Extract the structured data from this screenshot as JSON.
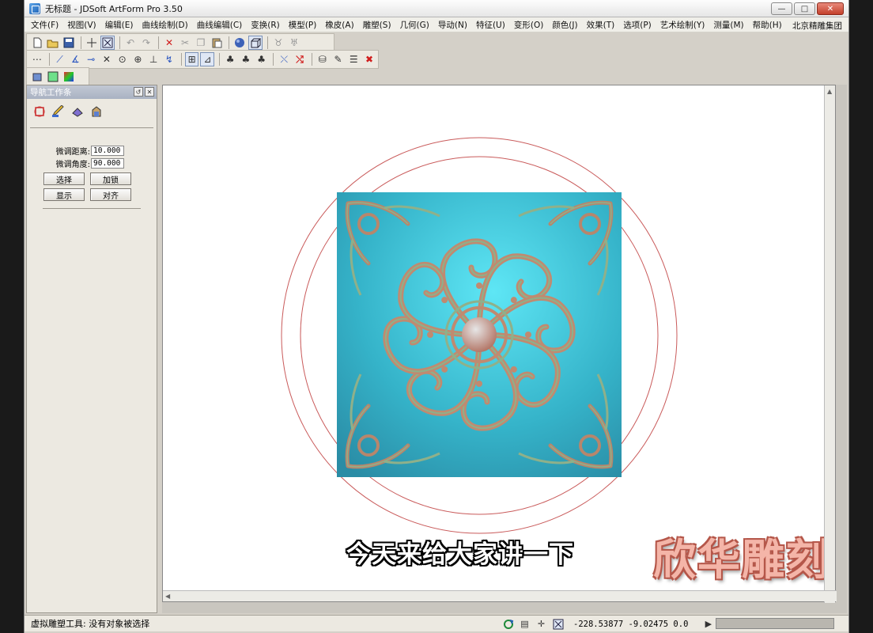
{
  "window": {
    "title": "无标题 - JDSoft ArtForm Pro 3.50",
    "controls": {
      "minimize": "—",
      "maximize": "□",
      "close": "✕"
    }
  },
  "menu": {
    "items": [
      "文件(F)",
      "视图(V)",
      "编辑(E)",
      "曲线绘制(D)",
      "曲线编辑(C)",
      "变换(R)",
      "模型(P)",
      "橡皮(A)",
      "雕塑(S)",
      "几何(G)",
      "导动(N)",
      "特征(U)",
      "变形(O)",
      "颜色(J)",
      "效果(T)",
      "选项(P)",
      "艺术绘制(Y)",
      "测量(M)",
      "帮助(H)"
    ],
    "company": "北京精雕集团"
  },
  "nav_panel": {
    "title": "导航工作条",
    "fields": [
      {
        "label": "微调距离:",
        "value": "10.000"
      },
      {
        "label": "微调角度:",
        "value": "90.000"
      }
    ],
    "buttons": [
      "选择",
      "加锁",
      "显示",
      "对齐"
    ]
  },
  "canvas": {
    "subtitle": "今天来给大家讲一下",
    "watermark": "欣华雕刻",
    "relief_colors": {
      "background": "#3fb3c8",
      "ornament": "#c08a70",
      "ornament_light": "#8fb08a",
      "circle": "#c95a5a"
    }
  },
  "status": {
    "message": "虚拟雕塑工具: 没有对象被选择",
    "coords": "-228.53877 -9.02475 0.0",
    "icons": [
      "refresh-icon",
      "page-icon",
      "crosshair-icon",
      "box-select-icon",
      "play-icon"
    ]
  }
}
